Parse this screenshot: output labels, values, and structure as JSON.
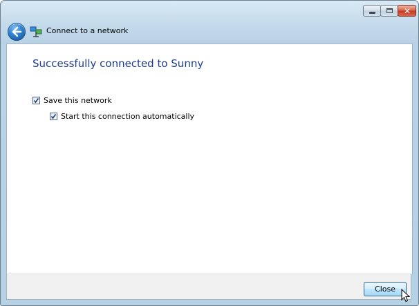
{
  "window": {
    "title": "Connect to a network",
    "controls": {
      "minimize_icon": "minimize-icon",
      "maximize_icon": "maximize-icon",
      "close_glyph": "✕"
    }
  },
  "icons": {
    "back": "back-arrow-icon",
    "network": "network-icon",
    "checkmark": "checkmark-icon",
    "cursor": "mouse-pointer-icon"
  },
  "content": {
    "heading": "Successfully connected to Sunny",
    "options": [
      {
        "label": "Save this network",
        "checked": true
      },
      {
        "label": "Start this connection automatically",
        "checked": true
      }
    ]
  },
  "footer": {
    "close_label": "Close"
  },
  "colors": {
    "heading": "#1e3d8f",
    "frame": "#b9d2e6",
    "close_control": "#c5391d"
  }
}
